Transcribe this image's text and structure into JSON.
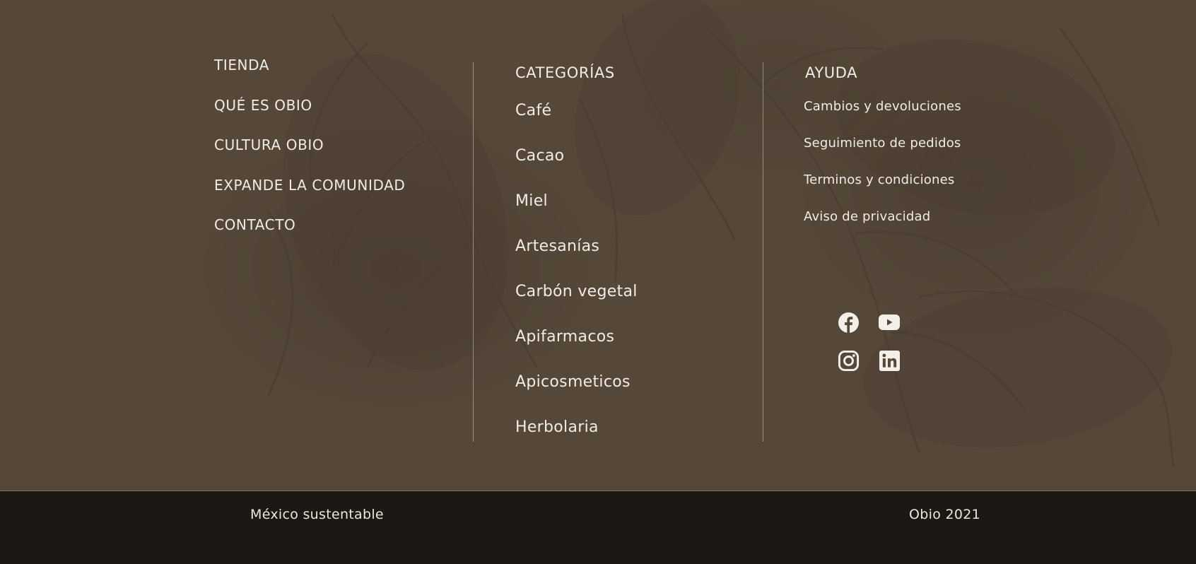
{
  "shop_nav": {
    "items": [
      {
        "label": "TIENDA"
      },
      {
        "label": "QUÉ ES OBIO"
      },
      {
        "label": "CULTURA OBIO"
      },
      {
        "label": "EXPANDE LA COMUNIDAD"
      },
      {
        "label": "CONTACTO"
      }
    ]
  },
  "categories": {
    "heading": "CATEGORÍAS",
    "items": [
      {
        "label": "Café"
      },
      {
        "label": "Cacao"
      },
      {
        "label": "Miel"
      },
      {
        "label": "Artesanías"
      },
      {
        "label": "Carbón vegetal"
      },
      {
        "label": "Apifarmacos"
      },
      {
        "label": "Apicosmeticos"
      },
      {
        "label": "Herbolaria"
      }
    ]
  },
  "help": {
    "heading": "AYUDA",
    "items": [
      {
        "label": "Cambios y devoluciones"
      },
      {
        "label": "Seguimiento de pedidos"
      },
      {
        "label": "Terminos y condiciones"
      },
      {
        "label": "Aviso de privacidad"
      }
    ]
  },
  "social": {
    "icons": [
      "facebook-icon",
      "youtube-icon",
      "instagram-icon",
      "linkedin-icon"
    ]
  },
  "bottom_bar": {
    "left_text": "México sustentable",
    "right_text": "Obio 2021"
  },
  "colors": {
    "footer_background": "#554839",
    "bottom_bar_background": "#1e1814",
    "text": "#f1ece5"
  }
}
